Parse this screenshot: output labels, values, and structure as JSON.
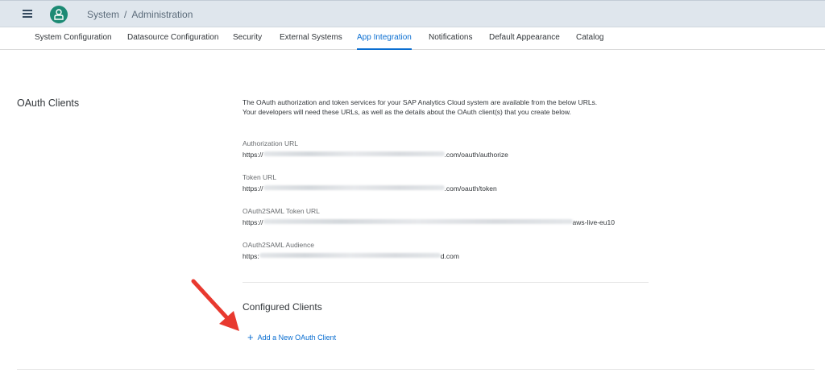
{
  "header": {
    "crumbs": [
      "System",
      "Administration"
    ],
    "separator": "/"
  },
  "tabs": [
    {
      "label": "System Configuration"
    },
    {
      "label": "Datasource Configuration"
    },
    {
      "label": "Security"
    },
    {
      "label": "External Systems"
    },
    {
      "label": "App Integration",
      "active": true
    },
    {
      "label": "Notifications"
    },
    {
      "label": "Default Appearance"
    },
    {
      "label": "Catalog"
    }
  ],
  "oauth": {
    "section_title": "OAuth Clients",
    "intro": "The OAuth authorization and token services for your SAP Analytics Cloud system are available from the below URLs. Your developers will need these URLs, as well as the details about the OAuth client(s) that you create below.",
    "fields": [
      {
        "label": "Authorization URL",
        "prefix": "https://",
        "suffix": ".com/oauth/authorize"
      },
      {
        "label": "Token URL",
        "prefix": "https://",
        "suffix": ".com/oauth/token"
      },
      {
        "label": "OAuth2SAML Token URL",
        "prefix": "https://",
        "suffix": "aws-live-eu10"
      },
      {
        "label": "OAuth2SAML Audience",
        "prefix": "https:",
        "suffix": "d.com"
      }
    ]
  },
  "configured_clients": {
    "title": "Configured Clients",
    "add_label": "Add a New OAuth Client",
    "add_icon": "+"
  },
  "colors": {
    "accent": "#0a6ed1",
    "header_bg": "#dfe6ed",
    "avatar": "#1c8a74",
    "annotation_arrow": "#e8392f"
  }
}
